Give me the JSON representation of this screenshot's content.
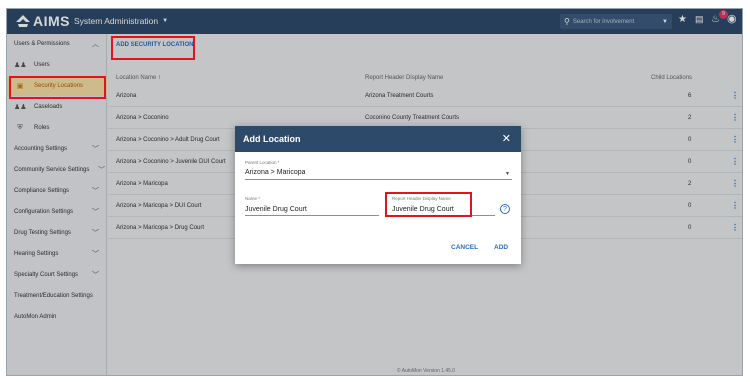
{
  "header": {
    "logo_text": "AIMS",
    "section": "System Administration",
    "search_placeholder": "Search for involvement",
    "notification_count": "9"
  },
  "sidebar": {
    "groups": [
      {
        "label": "Users & Permissions",
        "expanded": true
      },
      {
        "label": "Accounting Settings"
      },
      {
        "label": "Community Service Settings"
      },
      {
        "label": "Compliance Settings"
      },
      {
        "label": "Configuration Settings"
      },
      {
        "label": "Drug Testing Settings"
      },
      {
        "label": "Hearing Settings"
      },
      {
        "label": "Specialty Court Settings"
      },
      {
        "label": "Treatment/Education Settings"
      },
      {
        "label": "AutoMon Admin"
      }
    ],
    "sub_items": [
      {
        "label": "Users",
        "icon": "users-icon"
      },
      {
        "label": "Security Locations",
        "icon": "building-icon",
        "active": true
      },
      {
        "label": "Caseloads",
        "icon": "caseloads-icon"
      },
      {
        "label": "Roles",
        "icon": "shield-icon"
      }
    ]
  },
  "main": {
    "add_button": "ADD SECURITY LOCATION",
    "columns": [
      "Location Name",
      "Report Header Display Name",
      "Child Locations"
    ],
    "rows": [
      {
        "name": "Arizona",
        "header": "Arizona Treatment Courts",
        "children": "6"
      },
      {
        "name": "Arizona > Coconino",
        "header": "Coconino County Treatment Courts",
        "children": "2"
      },
      {
        "name": "Arizona > Coconino > Adult Drug Court",
        "header": "",
        "children": "0"
      },
      {
        "name": "Arizona > Coconino > Juvenile DUI Court",
        "header": "",
        "children": "0"
      },
      {
        "name": "Arizona > Maricopa",
        "header": "",
        "children": "2"
      },
      {
        "name": "Arizona > Maricopa > DUI Court",
        "header": "",
        "children": "0"
      },
      {
        "name": "Arizona > Maricopa > Drug Court",
        "header": "",
        "children": "0"
      }
    ],
    "footer": "© AutoMon Version 1.45.0"
  },
  "modal": {
    "title": "Add Location",
    "parent_label": "Parent Location *",
    "parent_value": "Arizona > Maricopa",
    "name_label": "Name *",
    "name_value": "Juvenile Drug Court",
    "report_label": "Report Header Display Name",
    "report_value": "Juvenile Drug Court",
    "cancel": "CANCEL",
    "add": "ADD"
  },
  "colors": {
    "header_bg": "#2e4a6b",
    "accent": "#2b6cc4",
    "highlight_box": "#e0141b",
    "active_bg": "#f5dfa6"
  }
}
